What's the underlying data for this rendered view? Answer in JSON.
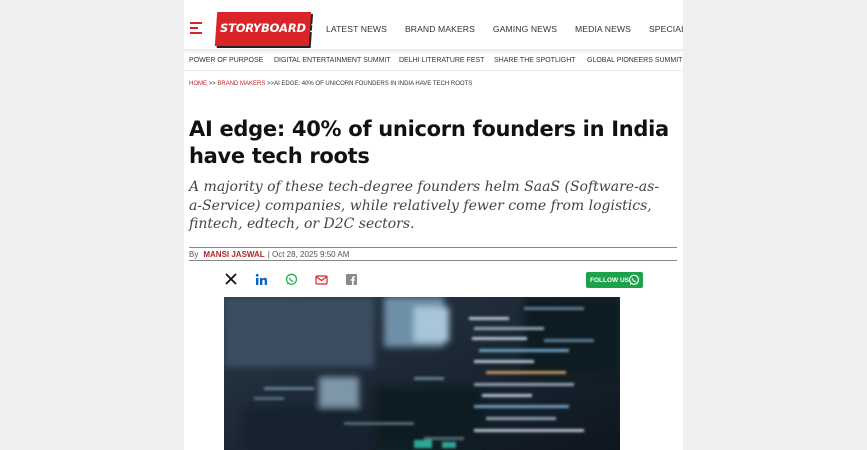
{
  "logo": {
    "text": "STORYBOARD 18"
  },
  "nav": [
    "LATEST NEWS",
    "BRAND MAKERS",
    "GAMING NEWS",
    "MEDIA NEWS",
    "SPECIAL COVERAGE"
  ],
  "subnav": [
    "POWER OF PURPOSE",
    "DIGITAL ENTERTAINMENT SUMMIT",
    "DELHI LITERATURE FEST",
    "SHARE THE SPOTLIGHT",
    "GLOBAL PIONEERS SUMMIT"
  ],
  "breadcrumb": {
    "home": "HOME",
    "sep1": ">>",
    "section": "BRAND MAKERS",
    "sep2": ">>",
    "current": "AI EDGE: 40% OF UNICORN FOUNDERS IN INDIA HAVE TECH ROOTS"
  },
  "article": {
    "headline": "AI edge: 40% of unicorn founders in India have tech roots",
    "subheadline": "A majority of these tech-degree founders helm SaaS (Software-as-a-Service) companies, while relatively fewer come from logistics, fintech, edtech, or D2C sectors.",
    "by_label": "By",
    "author": "MANSI JASWAL",
    "date": "| Oct 28, 2025 9:50 AM"
  },
  "share": {
    "icons": [
      "x-icon",
      "linkedin-icon",
      "whatsapp-icon",
      "email-icon",
      "facebook-icon"
    ],
    "follow_label": "FOLLOW US"
  },
  "colors": {
    "brand_red": "#d9252a",
    "link_red": "#b3282d",
    "whatsapp_green": "#1da24b"
  }
}
